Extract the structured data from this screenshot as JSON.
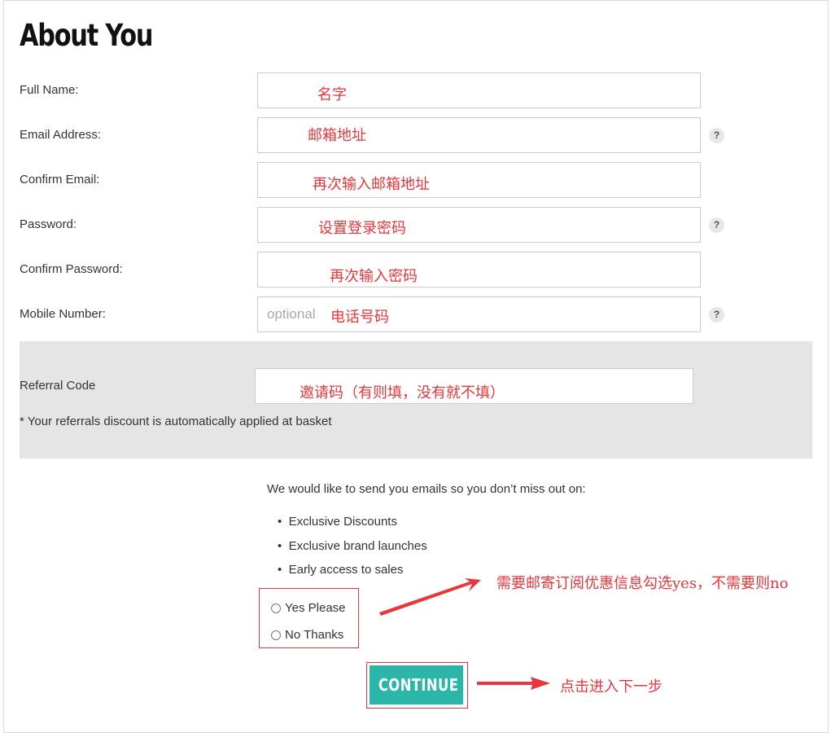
{
  "page": {
    "title": "About You"
  },
  "fields": [
    {
      "label": "Full Name:",
      "value": "",
      "placeholder": "",
      "annotation": "名字"
    },
    {
      "label": "Email Address:",
      "value": "",
      "placeholder": "",
      "annotation": "邮箱地址",
      "help": "?"
    },
    {
      "label": "Confirm Email:",
      "value": "",
      "placeholder": "",
      "annotation": "再次输入邮箱地址"
    },
    {
      "label": "Password:",
      "value": "",
      "placeholder": "",
      "annotation": "设置登录密码",
      "help": "?"
    },
    {
      "label": "Confirm Password:",
      "value": "",
      "placeholder": "",
      "annotation": "再次输入密码"
    },
    {
      "label": "Mobile Number:",
      "value": "",
      "placeholder": "optional",
      "annotation": "电话号码",
      "help": "?"
    }
  ],
  "referral": {
    "label": "Referral Code",
    "value": "",
    "annotation": "邀请码（有则填，没有就不填）",
    "note": "* Your referrals discount is automatically applied at basket"
  },
  "marketing": {
    "intro": "We would like to send you emails so you don’t miss out on:",
    "benefits": [
      "Exclusive Discounts",
      "Exclusive brand launches",
      "Early access to sales"
    ],
    "options": [
      "Yes Please",
      "No Thanks"
    ],
    "annotation": "需要邮寄订阅优惠信息勾选yes，不需要则no"
  },
  "submit": {
    "label": "CONTINUE",
    "annotation": "点击进入下一步"
  },
  "colors": {
    "accent": "#2ab7a9",
    "annotation_red": "#e8363b",
    "panel_gray": "#e5e5e5"
  }
}
